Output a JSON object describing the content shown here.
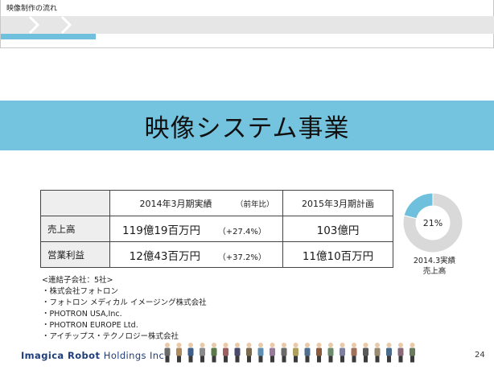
{
  "header": {
    "flow_label": "映像制作の流れ"
  },
  "title": "映像システム事業",
  "table": {
    "col_2014": "2014年3月期実績",
    "col_prev": "（前年比）",
    "col_2015": "2015年3月期計画",
    "rows": [
      {
        "label": "売上高",
        "actual": "119億19百万円",
        "change": "（+27.4%）",
        "plan": "103億円"
      },
      {
        "label": "営業利益",
        "actual": "12億43百万円",
        "change": "（+37.2%）",
        "plan": "11億10百万円"
      }
    ]
  },
  "donut": {
    "percent_label": "21%",
    "share": 0.21,
    "caption_line1": "2014.3実績",
    "caption_line2": "売上高",
    "colors": {
      "highlight": "#6fc0dd",
      "rest": "#d9d9d9"
    }
  },
  "notes": [
    "<連結子会社：5社>",
    "・株式会社フォトロン",
    "・フォトロン メディカル イメージング株式会社",
    "・PHOTRON USA,Inc.",
    "・PHOTRON EUROPE Ltd.",
    "・アイチップス・テクノロジー株式会社"
  ],
  "footer": {
    "logo_bold": "Imagica Robot",
    "logo_light": "Holdings Inc.",
    "page_number": "24"
  }
}
